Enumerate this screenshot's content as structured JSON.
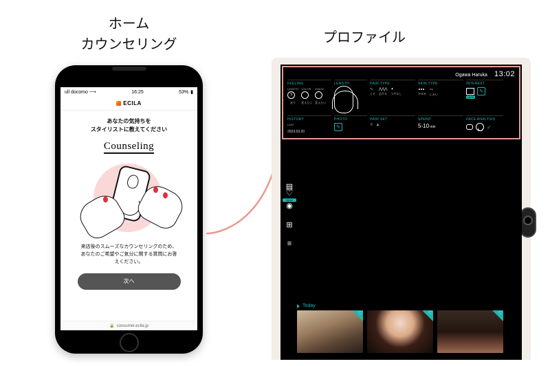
{
  "titles": {
    "left_line1": "ホーム",
    "left_line2": "カウンセリング",
    "right": "プロファイル"
  },
  "phone": {
    "status": {
      "carrier": "ull docomo ⟶",
      "time": "16:25",
      "battery": "53%"
    },
    "app_name": "ECILA",
    "lead": "あなたの気持ちを\nスタイリストに教えてください",
    "heading": "Counseling",
    "desc": "来店後のスムーズなカウンセリングのため、\nあなたのご希望やご気分に関する質問にお答\nえください。",
    "next": "次へ",
    "url": "consumer.ecila.jp",
    "lock": "🔒"
  },
  "kiosk": {
    "user": "Ogawa Haruka",
    "time": "13:02",
    "sections": {
      "feeling": "FEELING",
      "feeling_cols": [
        "LENGTH",
        "COLOR",
        "IMAGE"
      ],
      "feeling_vals": [
        "あり",
        "変えたい",
        "変えたい"
      ],
      "length": "LENGTH",
      "hairtype": "HAIR TYPE",
      "ht_vals": [
        "くせ",
        "広がる",
        "つやなし"
      ],
      "skintype": "SKIN TYPE",
      "st_vals": [
        "かゆみ",
        "におい"
      ],
      "interest": "INTEREST",
      "interest_new": "NEW",
      "history": "HISTORY",
      "history_last": "LAST",
      "history_date": "2023.03.20",
      "photo": "PHOTO",
      "hairset": "HAIR SET",
      "spend": "SPEND",
      "spend_val": "5-10",
      "spend_unit": "min",
      "face": "FACE ANALYSIS"
    },
    "rail_new": "NEW",
    "today": "Today"
  }
}
